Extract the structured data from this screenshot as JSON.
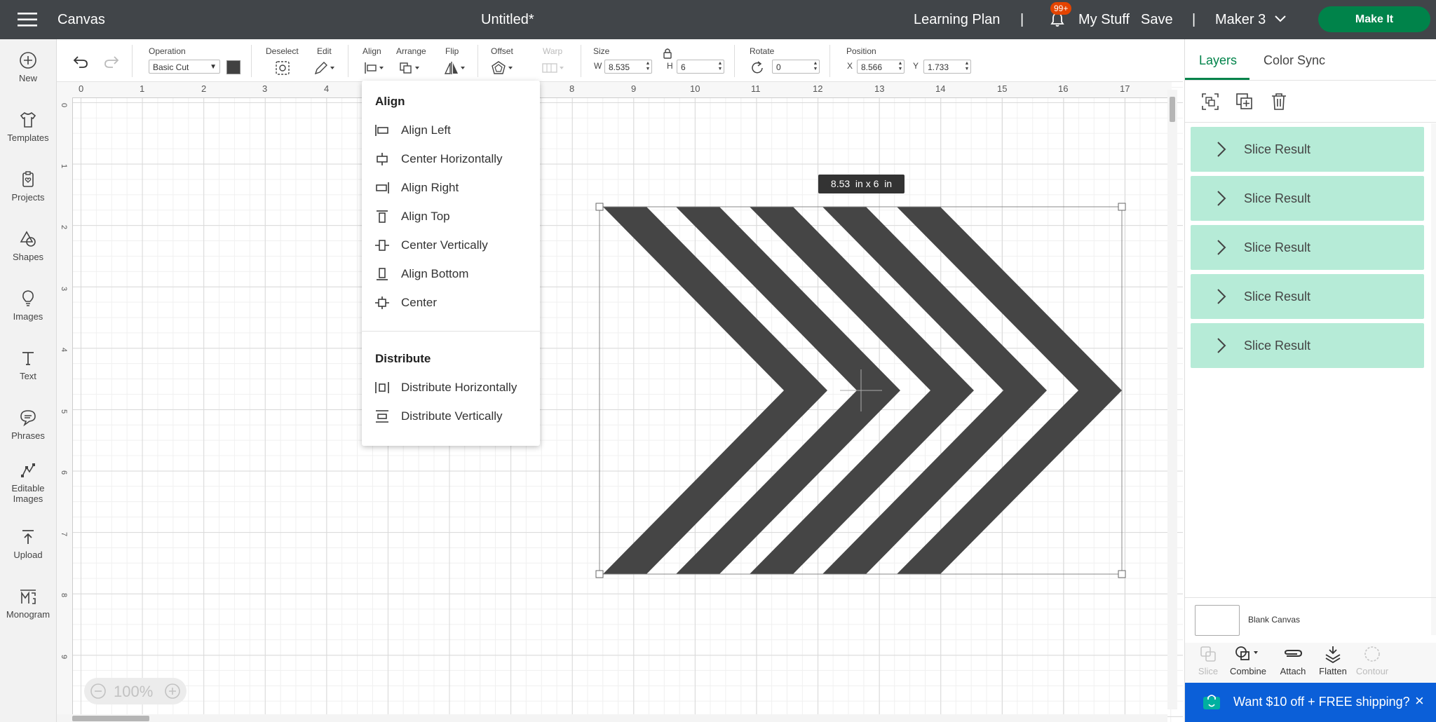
{
  "topbar": {
    "app_title": "Canvas",
    "doc_title": "Untitled*",
    "learning_plan": "Learning Plan",
    "sep1": "|",
    "notif_count": "99+",
    "my_stuff": "My Stuff",
    "save": "Save",
    "sep2": "|",
    "machine": "Maker 3",
    "make_it": "Make It"
  },
  "sidebar": {
    "items": [
      {
        "label": "New",
        "icon": "plus-circle-icon"
      },
      {
        "label": "Templates",
        "icon": "shirt-icon"
      },
      {
        "label": "Projects",
        "icon": "clipboard-heart-icon"
      },
      {
        "label": "Shapes",
        "icon": "shapes-icon"
      },
      {
        "label": "Images",
        "icon": "lightbulb-icon"
      },
      {
        "label": "Text",
        "icon": "text-t-icon"
      },
      {
        "label": "Phrases",
        "icon": "speech-bubble-icon"
      },
      {
        "label": "Editable",
        "label2": "Images",
        "icon": "editable-image-icon"
      },
      {
        "label": "Upload",
        "icon": "upload-icon"
      },
      {
        "label": "Monogram",
        "icon": "monogram-icon"
      }
    ]
  },
  "toolbar": {
    "operation_label": "Operation",
    "operation_value": "Basic Cut",
    "deselect_label": "Deselect",
    "edit_label": "Edit",
    "align_label": "Align",
    "arrange_label": "Arrange",
    "flip_label": "Flip",
    "offset_label": "Offset",
    "warp_label": "Warp",
    "size_label": "Size",
    "w_label": "W",
    "w_value": "8.535",
    "h_label": "H",
    "h_value": "6",
    "rotate_label": "Rotate",
    "rotate_value": "0",
    "position_label": "Position",
    "x_label": "X",
    "x_value": "8.566",
    "y_label": "Y",
    "y_value": "1.733"
  },
  "ruler": {
    "top": [
      "0",
      "1",
      "2",
      "3",
      "4",
      "8",
      "9",
      "10",
      "11",
      "12",
      "13",
      "14",
      "15",
      "16",
      "17"
    ],
    "left": [
      "0",
      "1",
      "2",
      "3",
      "4",
      "5",
      "6",
      "7",
      "8",
      "9"
    ]
  },
  "canvas": {
    "size_tooltip": "8.53  in x 6  in",
    "zoom": "100%"
  },
  "align_menu": {
    "align_heading": "Align",
    "align_items": [
      {
        "label": "Align Left",
        "icon": "align-left-icon"
      },
      {
        "label": "Center Horizontally",
        "icon": "center-horizontally-icon"
      },
      {
        "label": "Align Right",
        "icon": "align-right-icon"
      },
      {
        "label": "Align Top",
        "icon": "align-top-icon"
      },
      {
        "label": "Center Vertically",
        "icon": "center-vertically-icon"
      },
      {
        "label": "Align Bottom",
        "icon": "align-bottom-icon"
      },
      {
        "label": "Center",
        "icon": "center-icon"
      }
    ],
    "distribute_heading": "Distribute",
    "distribute_items": [
      {
        "label": "Distribute Horizontally",
        "icon": "distribute-horizontally-icon"
      },
      {
        "label": "Distribute Vertically",
        "icon": "distribute-vertically-icon"
      }
    ]
  },
  "right_panel": {
    "tabs": [
      "Layers",
      "Color Sync"
    ],
    "layers": [
      "Slice Result",
      "Slice Result",
      "Slice Result",
      "Slice Result",
      "Slice Result"
    ],
    "blank_canvas": "Blank Canvas",
    "tools": [
      {
        "label": "Slice",
        "enabled": false
      },
      {
        "label": "Combine",
        "enabled": true
      },
      {
        "label": "Attach",
        "enabled": true
      },
      {
        "label": "Flatten",
        "enabled": true
      },
      {
        "label": "Contour",
        "enabled": false
      }
    ],
    "promo": "Want $10 off + FREE shipping?",
    "promo_close": "×"
  },
  "colors": {
    "topbar": "#414549",
    "make_it": "#00834a",
    "layer_row": "#b6ebd7",
    "tab_active": "#00834a",
    "promo": "#0b5fd8",
    "chevron_fill": "#454545"
  }
}
